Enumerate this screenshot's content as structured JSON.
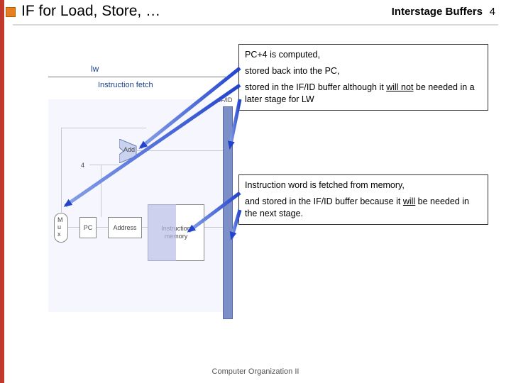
{
  "header": {
    "title": "IF for Load, Store, …",
    "right_label": "Interstage Buffers",
    "page_number": "4"
  },
  "pipeline": {
    "instr_label": "lw",
    "stage_label": "Instruction fetch",
    "ifid_label": "IF/ID",
    "mux_label": "M\nu\nx",
    "pc_label": "PC",
    "addr_label": "Address",
    "imem_label": "Instruction\nmemory",
    "four_label": "4",
    "add_label": "Add"
  },
  "box1": {
    "l1": "PC+4 is computed,",
    "l2": "stored back into the PC,",
    "l3a": "stored in the IF/ID buffer although it ",
    "l3u": "will not",
    "l3b": " be needed in a later stage for LW"
  },
  "box2": {
    "l1": "Instruction word is fetched from memory,",
    "l2a": "and stored in the IF/ID buffer because it ",
    "l2u": "will",
    "l2b": " be needed in the next stage."
  },
  "footer": {
    "text": "Computer Organization II"
  }
}
